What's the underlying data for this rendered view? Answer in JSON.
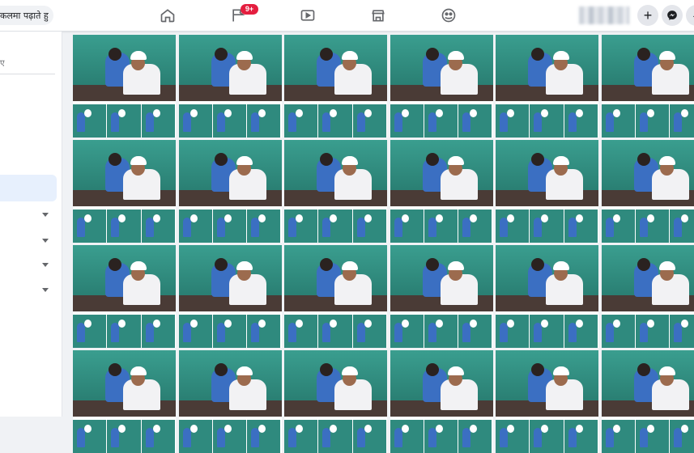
{
  "search": {
    "text": "कलमा पढ़ाते हु"
  },
  "nav": {
    "icons": [
      "home-icon",
      "flag-icon",
      "video-icon",
      "marketplace-icon",
      "groups-icon"
    ],
    "notification_badge": "9+"
  },
  "actions": {
    "create_label": "+",
    "messenger_icon": "messenger-icon",
    "notifications_icon": "bell-icon"
  },
  "sidebar": {
    "top_text": "ए"
  },
  "results": {
    "photo_count": 24,
    "caption": ""
  },
  "colors": {
    "badge": "#e41e3f",
    "active": "#e7f0fd"
  }
}
